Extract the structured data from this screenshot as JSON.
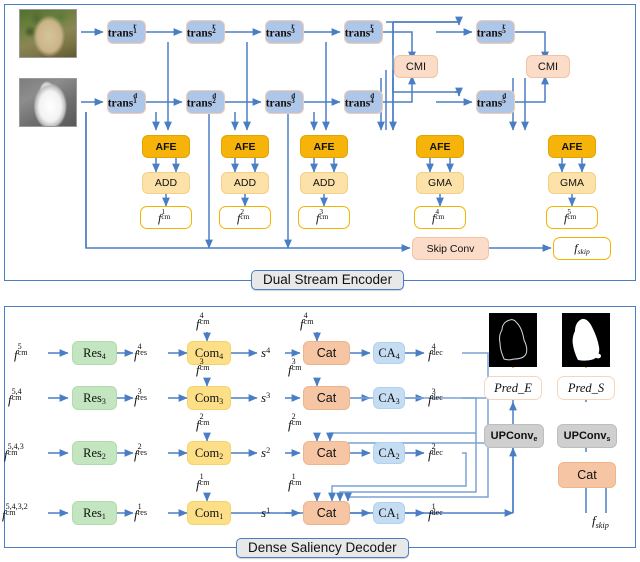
{
  "figure": {
    "panels": [
      {
        "id": "encoder",
        "caption": "Dual Stream Encoder"
      },
      {
        "id": "decoder",
        "caption": "Dense Saliency Decoder"
      }
    ]
  },
  "colors": {
    "panel_border": "#4a7ec4",
    "arrow_blue": "#4a7ec4",
    "arrow_orange": "#f6b40a",
    "trans_fill": "#aec6e8",
    "cmi_fill": "#fadcc8",
    "afe_fill": "#f6b40a",
    "add_fill": "#fce2a9",
    "fcm_border": "#f4b400",
    "res_fill": "#c3e6c0",
    "com_fill": "#fcdf86",
    "cat_fill": "#f6c6a4",
    "ca_fill": "#c5ddf2",
    "upconv_fill": "#cfcfcf",
    "skipconv_fill": "#fadcc8"
  },
  "encoder": {
    "inputs": [
      {
        "name": "rgb-image",
        "kind": "rgb"
      },
      {
        "name": "depth-image",
        "kind": "depth"
      }
    ],
    "rgb_stream": [
      {
        "base": "trans",
        "sup": "r",
        "sub": "1"
      },
      {
        "base": "trans",
        "sup": "r",
        "sub": "2"
      },
      {
        "base": "trans",
        "sup": "r",
        "sub": "3"
      },
      {
        "base": "trans",
        "sup": "r",
        "sub": "4"
      },
      {
        "base": "trans",
        "sup": "r",
        "sub": "5"
      }
    ],
    "depth_stream": [
      {
        "base": "trans",
        "sup": "d",
        "sub": "1"
      },
      {
        "base": "trans",
        "sup": "d",
        "sub": "2"
      },
      {
        "base": "trans",
        "sup": "d",
        "sub": "3"
      },
      {
        "base": "trans",
        "sup": "d",
        "sub": "4"
      },
      {
        "base": "trans",
        "sup": "d",
        "sub": "5"
      }
    ],
    "cmi_blocks": [
      {
        "label": "CMI",
        "stage": "4"
      },
      {
        "label": "CMI",
        "stage": "5"
      }
    ],
    "afe_label": "AFE",
    "afe_count": 5,
    "fusion_ops": [
      "ADD",
      "ADD",
      "ADD",
      "GMA",
      "GMA"
    ],
    "fcm_outputs": [
      {
        "base": "f",
        "sub": "cm",
        "sup": "1"
      },
      {
        "base": "f",
        "sub": "cm",
        "sup": "2"
      },
      {
        "base": "f",
        "sub": "cm",
        "sup": "3"
      },
      {
        "base": "f",
        "sub": "cm",
        "sup": "4"
      },
      {
        "base": "f",
        "sub": "cm",
        "sup": "5"
      }
    ],
    "skip_conv_label": "Skip Conv",
    "skip_output": {
      "base": "f",
      "sub": "skip"
    }
  },
  "decoder": {
    "rows": [
      {
        "input": {
          "base": "f",
          "sub": "cm",
          "sup": "5"
        },
        "res": {
          "base": "Res",
          "sub": "4"
        },
        "fres": {
          "base": "f",
          "sub": "res",
          "sup": "4"
        },
        "com": {
          "base": "Com",
          "sub": "4"
        },
        "s": {
          "base": "s",
          "sup": "4"
        },
        "com_top_input": {
          "base": "f",
          "sub": "cm",
          "sup": "4"
        },
        "cat": "Cat",
        "cat_top_input": {
          "base": "f",
          "sub": "cm",
          "sup": "4"
        },
        "ca": {
          "base": "CA",
          "sub": "4"
        },
        "fdec": {
          "base": "f",
          "sub": "dec",
          "sup": "4"
        }
      },
      {
        "input": {
          "base": "f",
          "sub": "cm",
          "sup": "5,4"
        },
        "res": {
          "base": "Res",
          "sub": "3"
        },
        "fres": {
          "base": "f",
          "sub": "res",
          "sup": "3"
        },
        "com": {
          "base": "Com",
          "sub": "3"
        },
        "s": {
          "base": "s",
          "sup": "3"
        },
        "com_top_input": {
          "base": "f",
          "sub": "cm",
          "sup": "3"
        },
        "cat": "Cat",
        "cat_top_input": {
          "base": "f",
          "sub": "cm",
          "sup": "3"
        },
        "ca": {
          "base": "CA",
          "sub": "3"
        },
        "fdec": {
          "base": "f",
          "sub": "dec",
          "sup": "3"
        }
      },
      {
        "input": {
          "base": "f",
          "sub": "cm",
          "sup": "5,4,3"
        },
        "res": {
          "base": "Res",
          "sub": "2"
        },
        "fres": {
          "base": "f",
          "sub": "res",
          "sup": "2"
        },
        "com": {
          "base": "Com",
          "sub": "2"
        },
        "s": {
          "base": "s",
          "sup": "2"
        },
        "com_top_input": {
          "base": "f",
          "sub": "cm",
          "sup": "2"
        },
        "cat": "Cat",
        "cat_top_input": {
          "base": "f",
          "sub": "cm",
          "sup": "2"
        },
        "ca": {
          "base": "CA",
          "sub": "2"
        },
        "fdec": {
          "base": "f",
          "sub": "dec",
          "sup": "2"
        }
      },
      {
        "input": {
          "base": "f",
          "sub": "cm",
          "sup": "5,4,3,2"
        },
        "res": {
          "base": "Res",
          "sub": "1"
        },
        "fres": {
          "base": "f",
          "sub": "res",
          "sup": "1"
        },
        "com": {
          "base": "Com",
          "sub": "1"
        },
        "s": {
          "base": "s",
          "sup": "1"
        },
        "com_top_input": {
          "base": "f",
          "sub": "cm",
          "sup": "1"
        },
        "cat": "Cat",
        "cat_top_input": {
          "base": "f",
          "sub": "cm",
          "sup": "1"
        },
        "ca": {
          "base": "CA",
          "sub": "1"
        },
        "fdec": {
          "base": "f",
          "sub": "dec",
          "sup": "1"
        }
      }
    ],
    "head": {
      "edge_branch": {
        "upconv": {
          "base": "UPConv",
          "sub": "e"
        },
        "pred": "Pred_E",
        "preview": "edge-map"
      },
      "saliency_branch": {
        "upconv": {
          "base": "UPConv",
          "sub": "s"
        },
        "cat": "Cat",
        "pred": "Pred_S",
        "preview": "saliency-map"
      },
      "skip_input": {
        "base": "f",
        "sub": "skip"
      }
    }
  }
}
